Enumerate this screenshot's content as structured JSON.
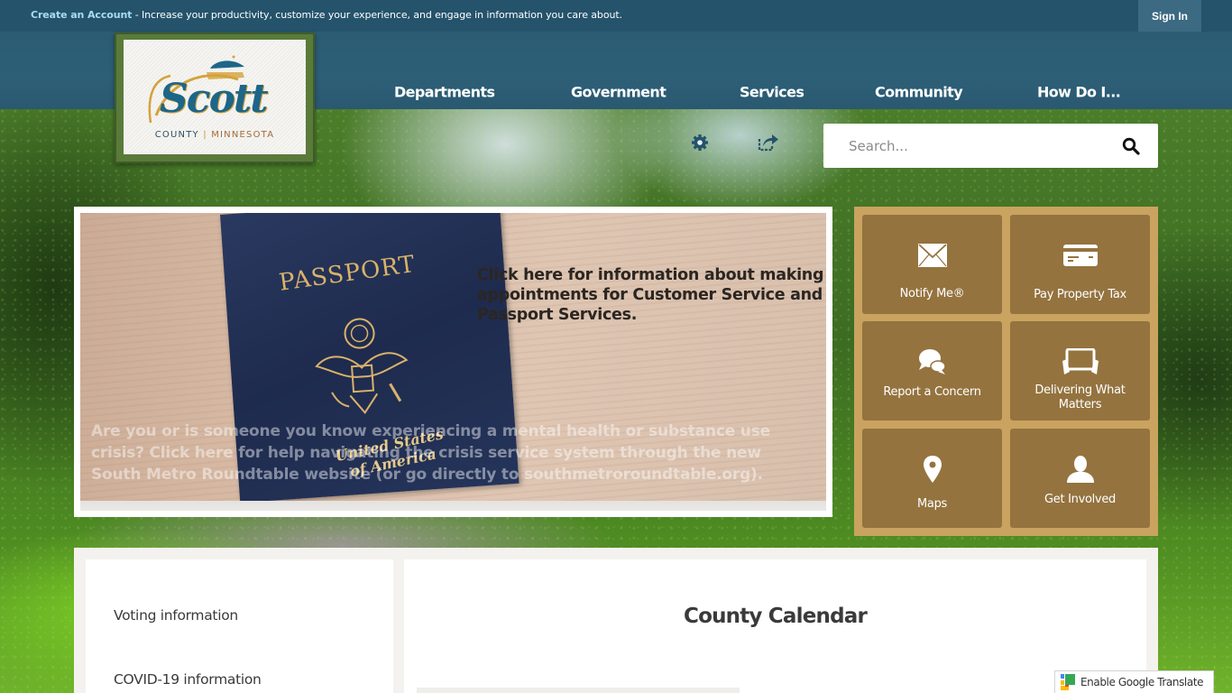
{
  "topbar": {
    "create_account_link": "Create an Account",
    "create_account_message": " - Increase your productivity, customize your experience, and engage in information you care about.",
    "sign_in_label": "Sign In"
  },
  "logo": {
    "name": "Scott",
    "county": "COUNTY",
    "separator": "|",
    "state": "MINNESOTA"
  },
  "nav": {
    "items": [
      {
        "label": "Departments"
      },
      {
        "label": "Government"
      },
      {
        "label": "Services"
      },
      {
        "label": "Community"
      },
      {
        "label": "How Do I..."
      }
    ]
  },
  "utility": {
    "settings_icon": "gear-icon",
    "share_icon": "share-icon"
  },
  "search": {
    "placeholder": "Search...",
    "value": "",
    "button_icon": "search-icon"
  },
  "slideshow": {
    "passport_title": "PASSPORT",
    "passport_sub_line1": "United States",
    "passport_sub_line2": "of America",
    "headline": "Click here for information about making appointments for Customer Service and Passport Services.",
    "subtext": "Are you or is someone you know experiencing a mental health or substance use crisis? Click here for help navigating the crisis service system through the new South Metro Roundtable website (or go directly to southmetroroundtable.org)."
  },
  "quick_links": [
    {
      "label": "Notify Me®",
      "icon": "envelope-icon"
    },
    {
      "label": "Pay Property Tax",
      "icon": "credit-card-icon"
    },
    {
      "label": "Report a Concern",
      "icon": "chat-bubbles-icon"
    },
    {
      "label": "Delivering What Matters",
      "icon": "tablet-hands-icon"
    },
    {
      "label": "Maps",
      "icon": "map-pin-icon"
    },
    {
      "label": "Get Involved",
      "icon": "person-icon"
    }
  ],
  "side_links": [
    {
      "label": "Voting information"
    },
    {
      "label": "COVID-19 information"
    }
  ],
  "calendar": {
    "title": "County Calendar"
  },
  "translate": {
    "label": "Enable Google Translate"
  },
  "colors": {
    "topbar": "#24536b",
    "navbar": "#2b5c74",
    "account_link": "#a8dcf5",
    "quick_links_bg": "#c9a35f",
    "quick_link_tile": "#94733f",
    "logo_blue": "#1d6688",
    "logo_gold": "#d4a23a"
  }
}
